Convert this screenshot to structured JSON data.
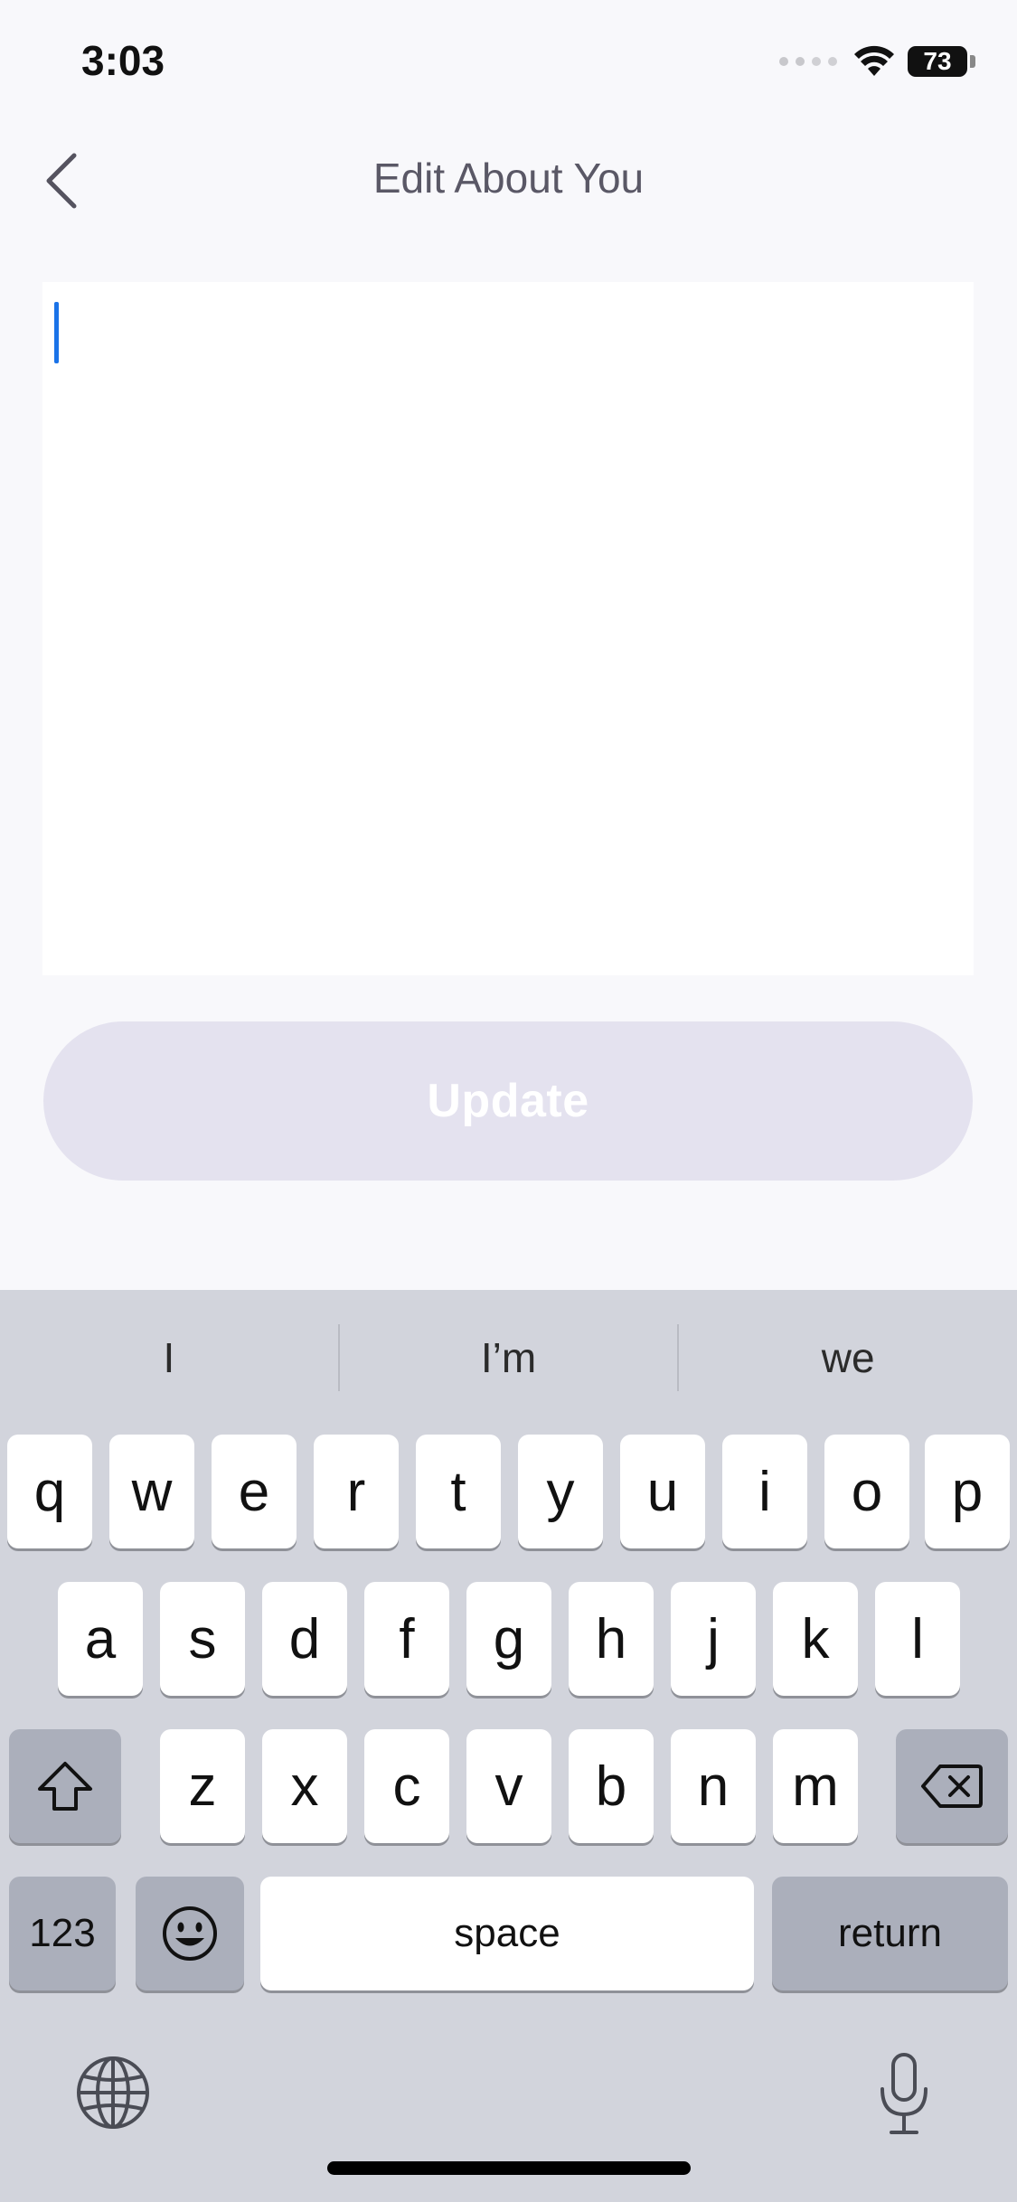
{
  "status_bar": {
    "time": "3:03",
    "battery": "73"
  },
  "nav": {
    "title": "Edit About You"
  },
  "editor": {
    "value": ""
  },
  "update_button": {
    "label": "Update"
  },
  "keyboard": {
    "suggestions": [
      "I",
      "I’m",
      "we"
    ],
    "row1": [
      "q",
      "w",
      "e",
      "r",
      "t",
      "y",
      "u",
      "i",
      "o",
      "p"
    ],
    "row2": [
      "a",
      "s",
      "d",
      "f",
      "g",
      "h",
      "j",
      "k",
      "l"
    ],
    "row3": [
      "z",
      "x",
      "c",
      "v",
      "b",
      "n",
      "m"
    ],
    "numbers_label": "123",
    "space_label": "space",
    "return_label": "return"
  },
  "icons": {
    "back": "chevron-left-icon",
    "shift": "shift-icon",
    "delete": "delete-icon",
    "emoji": "emoji-icon",
    "globe": "globe-icon",
    "mic": "microphone-icon",
    "wifi": "wifi-icon",
    "battery": "battery-icon"
  },
  "colors": {
    "caret": "#1a73e8",
    "update_disabled": "#e4e2ef",
    "keyboard_bg": "#d2d4dc"
  }
}
